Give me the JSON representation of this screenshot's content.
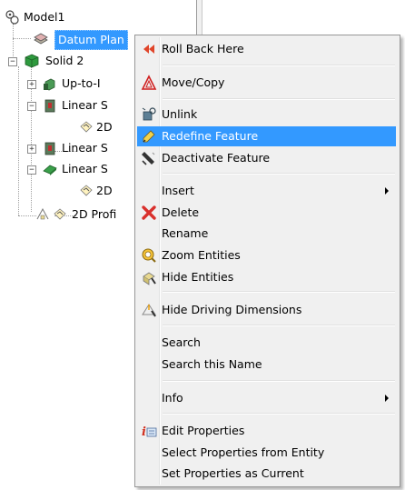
{
  "tree": {
    "root_label": "Model1",
    "items": [
      {
        "label": "Datum Plan",
        "selected": true
      },
      {
        "label": "Solid 2"
      },
      {
        "label": "Up-to-I"
      },
      {
        "label": "Linear S"
      },
      {
        "label": "2D"
      },
      {
        "label": "Linear S"
      },
      {
        "label": "Linear S"
      },
      {
        "label": "2D"
      },
      {
        "label": "2D Profi"
      }
    ]
  },
  "menu": {
    "items": [
      {
        "label": "Roll Back Here",
        "icon": "roll-back-icon"
      },
      {
        "label": "Move/Copy",
        "icon": "move-copy-icon"
      },
      {
        "label": "Unlink",
        "icon": "unlink-icon"
      },
      {
        "label": "Redefine Feature",
        "icon": "redefine-icon",
        "highlighted": true
      },
      {
        "label": "Deactivate Feature",
        "icon": "deactivate-icon"
      },
      {
        "label": "Insert",
        "submenu": true
      },
      {
        "label": "Delete",
        "icon": "delete-x-icon"
      },
      {
        "label": "Rename"
      },
      {
        "label": "Zoom Entities",
        "icon": "zoom-icon"
      },
      {
        "label": "Hide Entities",
        "icon": "hide-entities-icon"
      },
      {
        "label": "Hide Driving Dimensions",
        "icon": "hide-dimensions-icon"
      },
      {
        "label": "Search"
      },
      {
        "label": "Search this Name"
      },
      {
        "label": "Info",
        "submenu": true
      },
      {
        "label": "Edit Properties",
        "icon": "edit-properties-icon"
      },
      {
        "label": "Select Properties from Entity"
      },
      {
        "label": "Set Properties as Current"
      }
    ]
  },
  "colors": {
    "highlight": "#3399ff",
    "menu_bg": "#f0f0f0",
    "delete_red": "#d9302c"
  }
}
